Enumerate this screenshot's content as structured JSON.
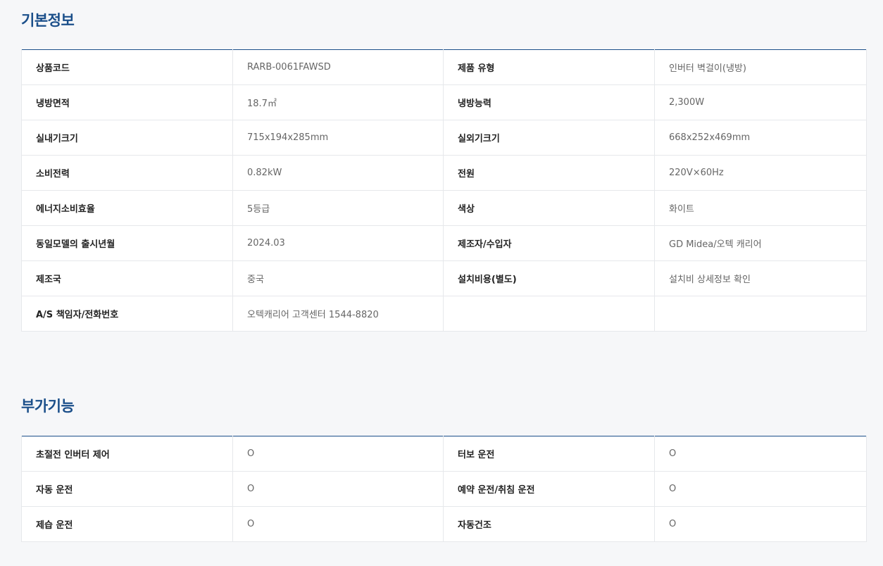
{
  "basic": {
    "title": "기본정보",
    "rows": [
      {
        "l1": "상품코드",
        "v1": "RARB-0061FAWSD",
        "l2": "제품 유형",
        "v2": "인버터 벽걸이(냉방)"
      },
      {
        "l1": "냉방면적",
        "v1": "18.7㎡",
        "l2": "냉방능력",
        "v2": "2,300W"
      },
      {
        "l1": "실내기크기",
        "v1": "715x194x285mm",
        "l2": "실외기크기",
        "v2": "668x252x469mm"
      },
      {
        "l1": "소비전력",
        "v1": "0.82kW",
        "l2": "전원",
        "v2": "220V×60Hz"
      },
      {
        "l1": "에너지소비효율",
        "v1": "5등급",
        "l2": "색상",
        "v2": "화이트"
      },
      {
        "l1": "동일모델의 출시년월",
        "v1": "2024.03",
        "l2": "제조자/수입자",
        "v2": "GD Midea/오텍 캐리어"
      },
      {
        "l1": "제조국",
        "v1": "중국",
        "l2": "설치비용(별도)",
        "v2": "설치비 상세정보 확인"
      },
      {
        "l1": "A/S 책임자/전화번호",
        "v1": "오텍캐리어 고객센터 1544-8820",
        "l2": "",
        "v2": ""
      }
    ]
  },
  "extra": {
    "title": "부가기능",
    "rows": [
      {
        "l1": "초절전 인버터 제어",
        "v1": "O",
        "l2": "터보 운전",
        "v2": "O"
      },
      {
        "l1": "자동 운전",
        "v1": "O",
        "l2": "예약 운전/취침 운전",
        "v2": "O"
      },
      {
        "l1": "제습 운전",
        "v1": "O",
        "l2": "자동건조",
        "v2": "O"
      }
    ]
  }
}
